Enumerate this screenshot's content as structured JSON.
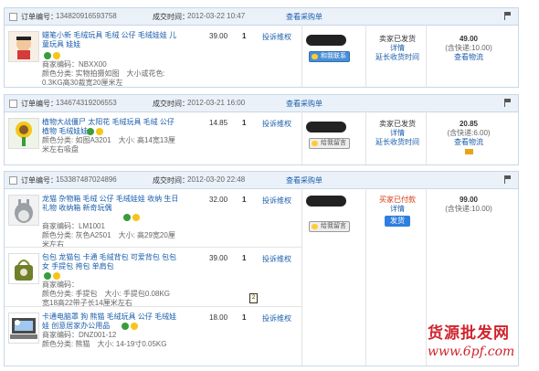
{
  "orders": [
    {
      "number_label": "订单编号：",
      "number": "134820916593758",
      "time_label": "成交时间：",
      "time": "2012-03-22 10:47",
      "view_link": "查看采购单",
      "buyer_chat": "和我联系",
      "status": [
        "卖家已发货",
        "详情",
        "延长收货时间"
      ],
      "total": "49.00",
      "shipping": "(含快递:10.00)",
      "logistics": "查看物流",
      "items": [
        {
          "title": "蜡笔小新 毛绒玩具 毛绒 公仔 毛绒娃娃 儿童玩具 娃娃",
          "code_label": "商家编码：",
          "code": "NBXX00",
          "spec": "颜色分类: 实物拍摄如图　大小或花色: 0.3KG高30裁宽20厘米左",
          "price": "39.00",
          "qty": "1",
          "complain": "投诉维权"
        }
      ]
    },
    {
      "number_label": "订单编号：",
      "number": "134674319206553",
      "time_label": "成交时间：",
      "time": "2012-03-21 16:00",
      "view_link": "查看采购单",
      "buyer_chat": "给我留言",
      "status": [
        "卖家已发货",
        "详情",
        "延长收货时间"
      ],
      "total": "20.85",
      "shipping": "(含快递:6.00)",
      "logistics": "查看物流",
      "items": [
        {
          "title": "植物大战僵尸 太阳花 毛绒玩具 毛绒 公仔 植物 毛绒娃娃",
          "code_label": "商家编码：",
          "code": "",
          "spec": "颜色分类: 如图A3201　大小: 高14宽13厘米左右吸盘",
          "price": "14.85",
          "qty": "1",
          "complain": "投诉维权"
        }
      ]
    },
    {
      "number_label": "订单编号：",
      "number": "153387487024896",
      "time_label": "成交时间：",
      "time": "2012-03-20 22:48",
      "view_link": "查看采购单",
      "buyer_chat": "给我留言",
      "status": [
        "买家已付款",
        "详情",
        "发货"
      ],
      "total": "99.00",
      "shipping": "(含快递:10.00)",
      "logistics": "",
      "items": [
        {
          "title": "龙猫 杂物箱 毛绒 公仔 毛绒娃娃 收纳 生日礼物 收纳箱 新奇玩偶",
          "code_label": "商家编码：",
          "code": "LM1001",
          "spec": "颜色分类: 灰色A2501　大小: 高29宽20厘米左右",
          "price": "32.00",
          "qty": "1",
          "complain": "投诉维权"
        },
        {
          "title": "包包 龙猫包 卡通 毛绒背包 可爱背包 包包 女 手提包 挎包 单肩包",
          "code_label": "商家编码：",
          "code": "",
          "spec": "颜色分类: 手提包　大小: 手提包0.08KG 宽18高22带子长14厘米左右",
          "price": "39.00",
          "qty": "1",
          "complain": "投诉维权"
        },
        {
          "title": "卡通电脑罩 狗 熊猫 毛绒玩具 公仔 毛绒娃娃 创意居家办公用品",
          "code_label": "商家编码：",
          "code": "DNZ001-12",
          "spec": "颜色分类: 熊猫　大小: 14-19寸0.05KG",
          "price": "18.00",
          "qty": "1",
          "complain": "投诉维权"
        }
      ]
    }
  ],
  "watermark": {
    "line1": "货源批发网",
    "line2": "www.6pf.com"
  }
}
